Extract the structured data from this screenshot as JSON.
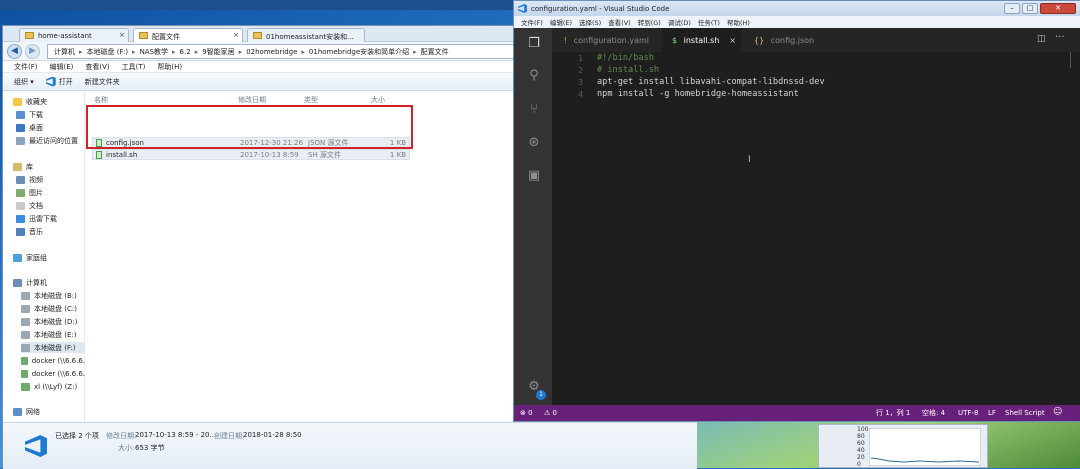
{
  "explorer": {
    "tabs": [
      {
        "label": "home-assistant"
      },
      {
        "label": "配置文件"
      },
      {
        "label": "01homeassistant安装和..."
      }
    ],
    "breadcrumb": [
      "计算机",
      "本地磁盘 (F:)",
      "NAS教学",
      "6.2",
      "9智能家居",
      "02homebridge",
      "01homebridge安装和简单介绍",
      "配置文件"
    ],
    "menu": [
      "文件(F)",
      "编辑(E)",
      "查看(V)",
      "工具(T)",
      "帮助(H)"
    ],
    "toolbar": {
      "organize": "组织 ▾",
      "open": "打开",
      "new_folder": "新建文件夹"
    },
    "sidebar": {
      "favorites": "收藏夹",
      "downloads": "下载",
      "desktop": "桌面",
      "recent": "最近访问的位置",
      "libraries": "库",
      "videos": "视频",
      "pictures": "图片",
      "documents": "文档",
      "thunder": "迅雷下载",
      "music": "音乐",
      "homegroup": "家庭组",
      "computer": "计算机",
      "drives": [
        "本地磁盘 (B:)",
        "本地磁盘 (C:)",
        "本地磁盘 (D:)",
        "本地磁盘 (E:)",
        "本地磁盘 (F:)",
        "docker (\\\\6.6.6.",
        "docker (\\\\6.6.6.",
        "xl (\\\\Lyf) (Z:)"
      ],
      "network": "网络"
    },
    "columns": {
      "name": "名称",
      "date": "修改日期",
      "type": "类型",
      "size": "大小"
    },
    "files": [
      {
        "name": "config.json",
        "date": "2017-12-30 21:26",
        "type": "JSON 源文件",
        "size": "1 KB"
      },
      {
        "name": "install.sh",
        "date": "2017-10-13 8:59",
        "type": "SH 源文件",
        "size": "1 KB"
      }
    ],
    "details": {
      "selected": "已选择 2 个项",
      "modified_label": "修改日期:",
      "modified_value": "2017-10-13 8:59 - 20...",
      "created_label": "创建日期:",
      "created_value": "2018-01-28 8:50",
      "size_label": "大小:",
      "size_value": "653 字节"
    }
  },
  "vscode": {
    "title": "configuration.yaml - Visual Studio Code",
    "menu": [
      "文件(F)",
      "编辑(E)",
      "选择(S)",
      "查看(V)",
      "转到(G)",
      "调试(D)",
      "任务(T)",
      "帮助(H)"
    ],
    "tabs": [
      {
        "label": "configuration.yaml",
        "icon": "!"
      },
      {
        "label": "install.sh",
        "icon": "$"
      },
      {
        "label": "config.json",
        "icon": "{}"
      }
    ],
    "tab_close": "×",
    "lines": [
      {
        "n": "1",
        "text": "#!/bin/bash"
      },
      {
        "n": "2",
        "text": "# install.sh"
      },
      {
        "n": "3",
        "text": "apt-get install libavahi-compat-libdnssd-dev"
      },
      {
        "n": "4",
        "text": "npm install -g homebridge-homeassistant"
      }
    ],
    "status": {
      "errors": "⊗ 0",
      "warnings": "⚠ 0",
      "position": "行 1，列 1",
      "spaces": "空格: 4",
      "encoding": "UTF-8",
      "eol": "LF",
      "language": "Shell Script"
    },
    "badge": "1",
    "colors": {
      "statusbar": "#68217a",
      "editor_bg": "#1e1e1e",
      "comment": "#608b4e"
    }
  },
  "perf": {
    "labels": [
      "100",
      "80",
      "60",
      "40",
      "20",
      "0"
    ]
  }
}
